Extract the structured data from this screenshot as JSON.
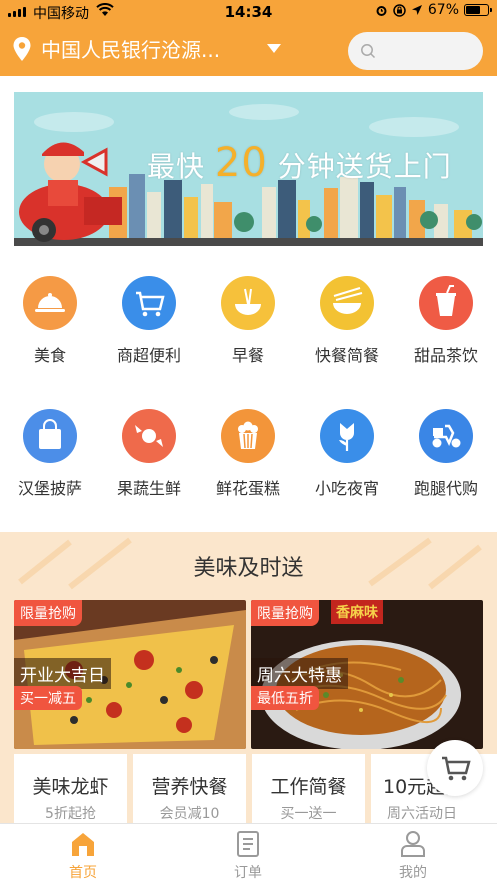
{
  "status_bar": {
    "carrier": "中国移动",
    "time": "14:34",
    "battery": "67%",
    "battery_level": 0.67
  },
  "header": {
    "location": "中国人民银行沧源...",
    "search_placeholder": ""
  },
  "banner": {
    "slogan_prefix": "最快",
    "slogan_number": "20",
    "slogan_suffix": "分钟送货上门"
  },
  "categories": [
    {
      "label": "美食",
      "icon": "cloche-icon",
      "color": "#f59a45"
    },
    {
      "label": "商超便利",
      "icon": "shopping-cart-icon",
      "color": "#3a8ee9"
    },
    {
      "label": "早餐",
      "icon": "noodle-bowl-icon",
      "color": "#f6c13b"
    },
    {
      "label": "快餐简餐",
      "icon": "chopsticks-bowl-icon",
      "color": "#f3c233"
    },
    {
      "label": "甜品茶饮",
      "icon": "drink-cup-icon",
      "color": "#ef5b45"
    },
    {
      "label": "汉堡披萨",
      "icon": "bag-icon",
      "color": "#4c8ee8"
    },
    {
      "label": "果蔬生鲜",
      "icon": "candy-icon",
      "color": "#ef6a4b"
    },
    {
      "label": "鲜花蛋糕",
      "icon": "popcorn-icon",
      "color": "#f3953a"
    },
    {
      "label": "小吃夜宵",
      "icon": "flower-icon",
      "color": "#3a8ee9"
    },
    {
      "label": "跑腿代购",
      "icon": "scooter-icon",
      "color": "#3a86e6"
    }
  ],
  "promo": {
    "title": "美味及时送",
    "cards": [
      {
        "tag": "限量抢购",
        "headline": "开业大吉日",
        "offer": "买一减五"
      },
      {
        "tag": "限量抢购",
        "headline": "周六大特惠",
        "offer": "最低五折",
        "overlay": "香麻味"
      }
    ],
    "minis": [
      {
        "title": "美味龙虾",
        "sub": "5折起抢"
      },
      {
        "title": "营养快餐",
        "sub": "会员减10"
      },
      {
        "title": "工作简餐",
        "sub": "买一送一"
      },
      {
        "title": "10元起抢",
        "sub": "周六活动日"
      }
    ]
  },
  "tabbar": {
    "tabs": [
      {
        "label": "首页",
        "active": true
      },
      {
        "label": "订单",
        "active": false
      },
      {
        "label": "我的",
        "active": false
      }
    ],
    "active_color": "#f7a43a",
    "inactive_color": "#9a9a9a"
  }
}
